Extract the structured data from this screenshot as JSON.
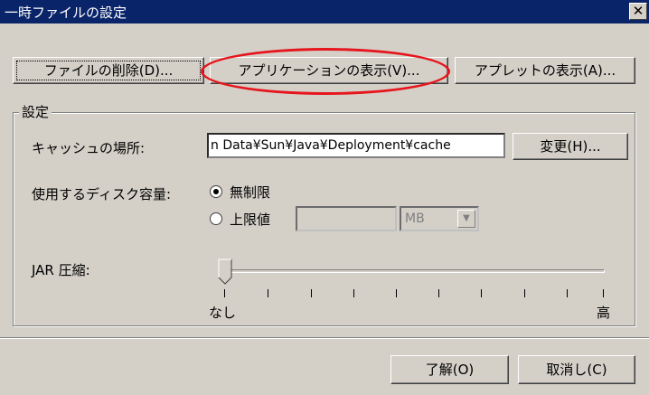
{
  "window": {
    "title": "一時ファイルの設定",
    "close_glyph": "✕"
  },
  "top_buttons": {
    "delete_files": "ファイルの削除(D)...",
    "view_applications": "アプリケーションの表示(V)...",
    "view_applets": "アプレットの表示(A)..."
  },
  "settings": {
    "group_label": "設定",
    "cache_location_label": "キャッシュの場所:",
    "cache_location_value": "n Data¥Sun¥Java¥Deployment¥cache",
    "change_button": "変更(H)...",
    "disk_space_label": "使用するディスク容量:",
    "disk_space_options": [
      "無制限",
      "上限値"
    ],
    "disk_space_selected": "無制限",
    "limit_value": "",
    "limit_unit": "MB",
    "jar_compression_label": "JAR 圧縮:",
    "jar_min_label": "なし",
    "jar_max_label": "高",
    "jar_level": 0
  },
  "footer": {
    "ok_button": "了解(O)",
    "cancel_button": "取消し(C)"
  },
  "annotation_color": "#e6151d"
}
